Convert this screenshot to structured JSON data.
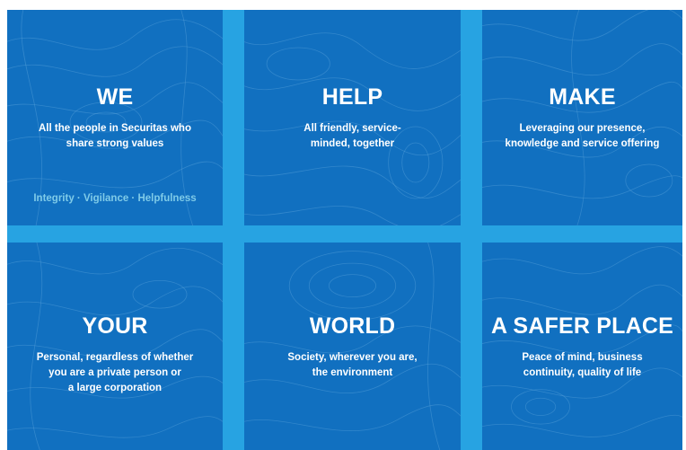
{
  "tiles": [
    {
      "title": "WE",
      "text": "All the people in Securitas who\nshare strong values",
      "values": "Integrity · Vigilance · Helpfulness"
    },
    {
      "title": "HELP",
      "text": "All friendly, service-\nminded, together"
    },
    {
      "title": "MAKE",
      "text": "Leveraging our presence,\nknowledge and service offering"
    },
    {
      "title": "YOUR",
      "text": "Personal, regardless of whether\nyou are a private person or\na large corporation"
    },
    {
      "title": "WORLD",
      "text": "Society, wherever you are,\nthe environment"
    },
    {
      "title": "A SAFER PLACE",
      "text": "Peace of mind, business\ncontinuity, quality of life"
    }
  ],
  "colors": {
    "tile": "#1170c0",
    "gap": "#27a3e2",
    "values_text": "#7fcbe8",
    "text": "#ffffff"
  }
}
